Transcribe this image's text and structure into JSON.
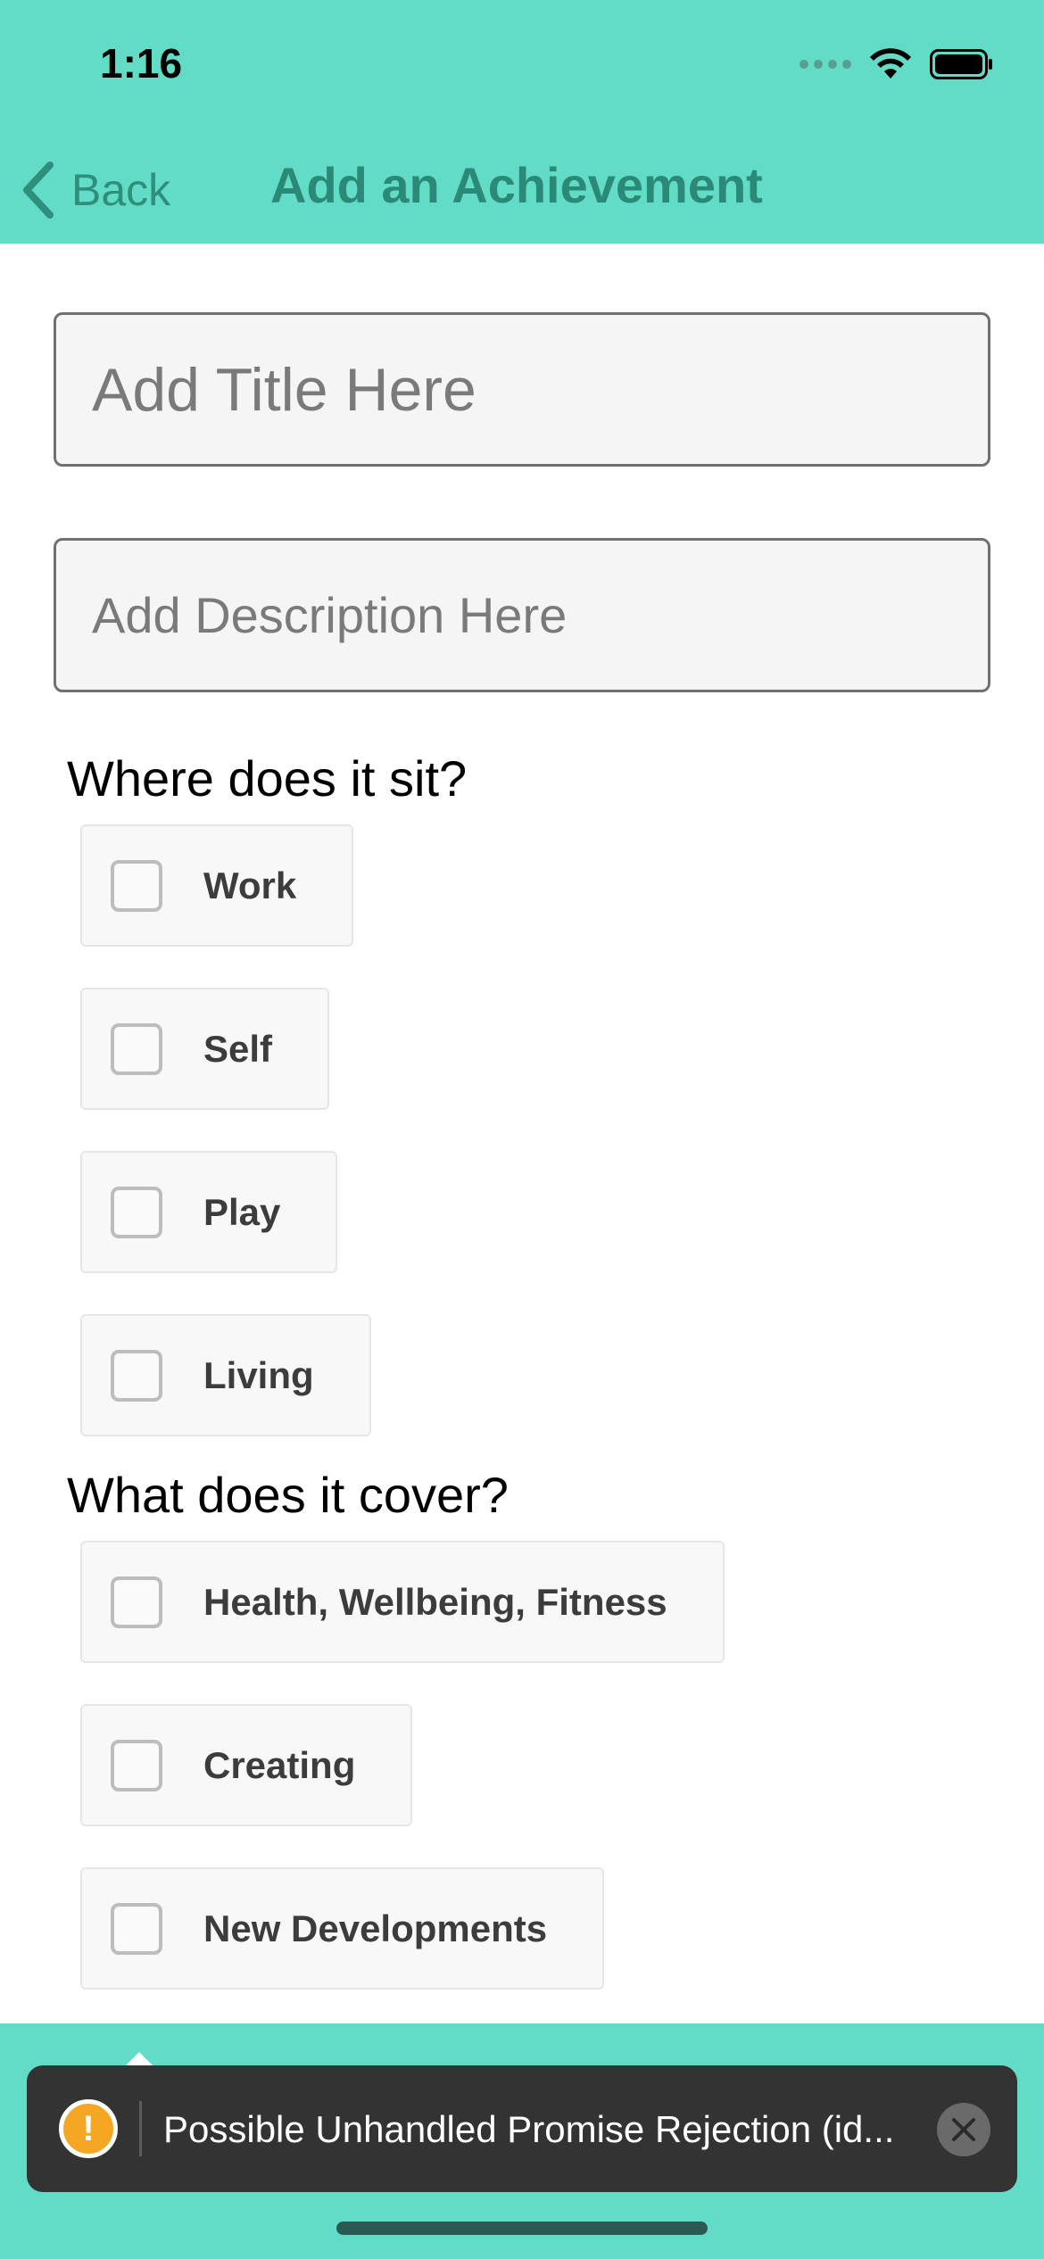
{
  "status_bar": {
    "time": "1:16"
  },
  "nav": {
    "back_label": "Back",
    "title": "Add an Achievement"
  },
  "form": {
    "title_placeholder": "Add Title Here",
    "description_placeholder": "Add Description Here",
    "where_heading": "Where does it sit?",
    "where_options": [
      "Work",
      "Self",
      "Play",
      "Living"
    ],
    "cover_heading": "What does it cover?",
    "cover_options": [
      "Health, Wellbeing, Fitness",
      "Creating",
      "New Developments"
    ]
  },
  "toast": {
    "message": "Possible Unhandled Promise Rejection (id..."
  },
  "colors": {
    "header": "#62dcc6",
    "title": "#2a8a77",
    "toast_bg": "#333333",
    "warning": "#f5a623"
  },
  "icons": {
    "back": "chevron-left-icon",
    "wifi": "wifi-icon",
    "battery": "battery-icon",
    "warning": "exclamation-icon",
    "close": "close-icon"
  }
}
